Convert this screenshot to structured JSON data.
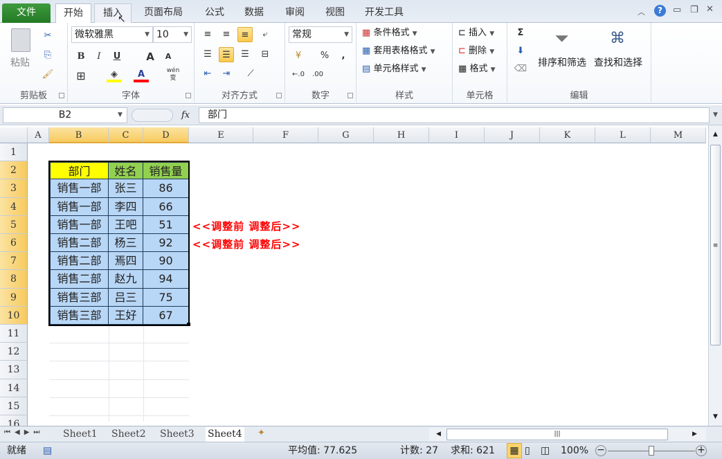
{
  "tabs": {
    "file": "文件",
    "items": [
      "开始",
      "插入",
      "页面布局",
      "公式",
      "数据",
      "审阅",
      "视图",
      "开发工具"
    ],
    "active": "开始"
  },
  "ribbon": {
    "clipboard": {
      "paste": "粘贴",
      "label": "剪贴板"
    },
    "font": {
      "name": "微软雅黑",
      "size": "10",
      "bold": "B",
      "italic": "I",
      "underline": "U",
      "grow": "A",
      "shrink": "A",
      "phonetic": "wén",
      "label": "字体",
      "fill_color": "#ffff00",
      "font_color": "#ff0000"
    },
    "alignment": {
      "label": "对齐方式"
    },
    "number": {
      "format": "常规",
      "percent": "%",
      "comma": ",",
      "label": "数字"
    },
    "styles": {
      "conditional": "条件格式",
      "table": "套用表格格式",
      "cell": "单元格样式",
      "label": "样式"
    },
    "cells": {
      "insert": "插入",
      "delete": "删除",
      "format": "格式",
      "label": "单元格"
    },
    "editing": {
      "sum": "Σ",
      "sort": "排序和筛选",
      "find": "查找和选择",
      "label": "编辑"
    }
  },
  "formula_bar": {
    "name_box": "B2",
    "fx": "fx",
    "content": "部门"
  },
  "columns": [
    "A",
    "B",
    "C",
    "D",
    "E",
    "F",
    "G",
    "H",
    "I",
    "J",
    "K",
    "L",
    "M"
  ],
  "selected_columns": [
    "B",
    "C",
    "D"
  ],
  "rows": [
    "1",
    "2",
    "3",
    "4",
    "5",
    "6",
    "7",
    "8",
    "9",
    "10",
    "11",
    "12",
    "13",
    "14",
    "15",
    "16"
  ],
  "table": {
    "header": [
      "部门",
      "姓名",
      "销售量"
    ],
    "header_colors": [
      "#ffff00",
      "#92d050",
      "#92d050"
    ],
    "body_color": "#b8d6f5",
    "rows": [
      [
        "销售一部",
        "张三",
        "86"
      ],
      [
        "销售一部",
        "李四",
        "66"
      ],
      [
        "销售一部",
        "王吧",
        "51"
      ],
      [
        "销售二部",
        "杨三",
        "92"
      ],
      [
        "销售二部",
        "焉四",
        "90"
      ],
      [
        "销售二部",
        "赵九",
        "94"
      ],
      [
        "销售三部",
        "吕三",
        "75"
      ],
      [
        "销售三部",
        "王好",
        "67"
      ]
    ]
  },
  "notes": [
    {
      "row": "5",
      "text": "<<调整前  调整后>>"
    },
    {
      "row": "6",
      "text": "<<调整前  调整后>>"
    }
  ],
  "sheet_tabs": [
    "Sheet1",
    "Sheet2",
    "Sheet3",
    "Sheet4"
  ],
  "active_sheet": "Sheet4",
  "status": {
    "ready": "就绪",
    "average": "平均值: 77.625",
    "count": "计数: 27",
    "sum": "求和: 621",
    "zoom": "100%",
    "zoom_level": 100
  }
}
